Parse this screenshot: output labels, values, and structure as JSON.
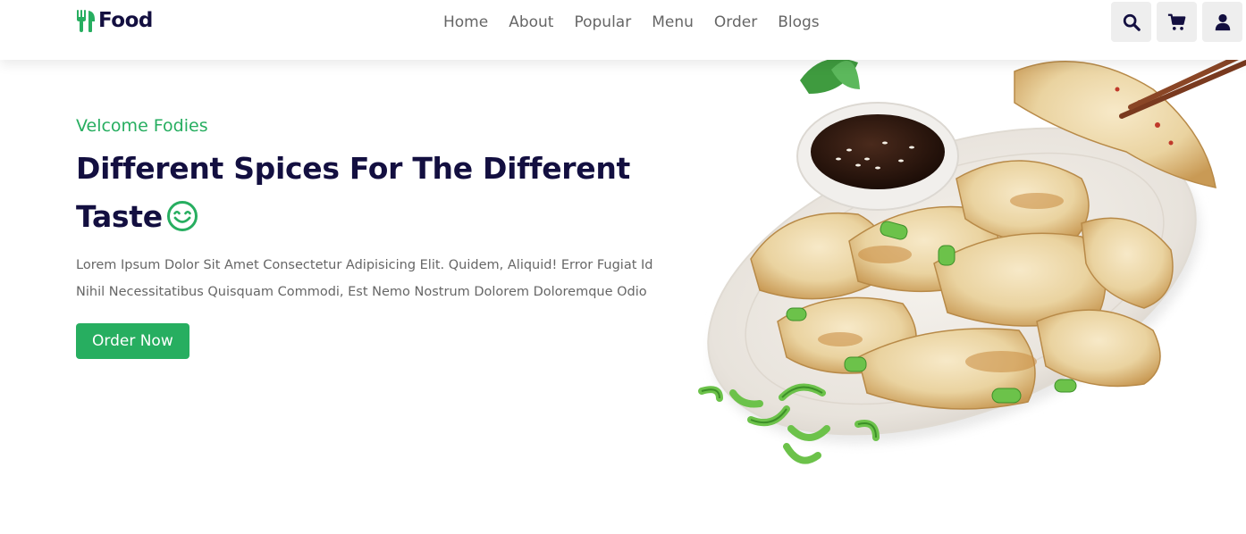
{
  "brand": {
    "name": "Food",
    "logo_icon": "utensils-icon",
    "accent_color": "#27ae60",
    "text_color": "#130f40"
  },
  "nav": {
    "items": [
      {
        "label": "Home"
      },
      {
        "label": "About"
      },
      {
        "label": "Popular"
      },
      {
        "label": "Menu"
      },
      {
        "label": "Order"
      },
      {
        "label": "Blogs"
      }
    ]
  },
  "header_icons": [
    {
      "icon": "search-icon"
    },
    {
      "icon": "cart-icon"
    },
    {
      "icon": "user-icon"
    }
  ],
  "hero": {
    "greeting": "Velcome Fodies",
    "heading": "Different Spices For The Different Taste",
    "heading_icon": "smile-icon",
    "description": "Lorem Ipsum Dolor Sit Amet Consectetur Adipisicing Elit. Quidem, Aliquid! Error Fugiat Id Nihil Necessitatibus Quisquam Commodi, Est Nemo Nostrum Dolorem Doloremque Odio",
    "cta_label": "Order Now",
    "image": "dumplings-plate-image"
  }
}
